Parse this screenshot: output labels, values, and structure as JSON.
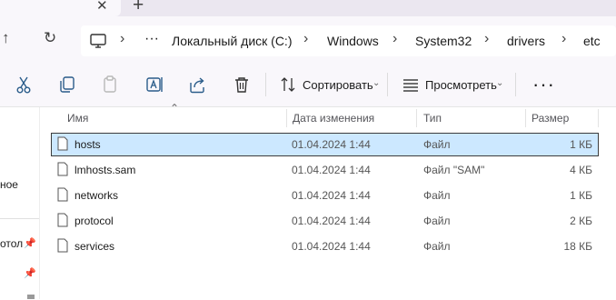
{
  "tabbar": {
    "close_glyph": "✕",
    "new_tab_glyph": "+"
  },
  "nav": {
    "up_glyph": "↑",
    "refresh_glyph": "↻",
    "crumb_more": "···",
    "crumbs": [
      "Локальный диск (C:)",
      "Windows",
      "System32",
      "drivers",
      "etc"
    ],
    "sep_glyph": "›"
  },
  "toolbar": {
    "sort_label": "Сортировать",
    "view_label": "Просмотреть",
    "chev_glyph": "⌄",
    "more_glyph": "···"
  },
  "sidebar": {
    "items": [
      "ное",
      "отол"
    ],
    "pin_glyph": "📌"
  },
  "columns": {
    "name": "Имя",
    "date": "Дата изменения",
    "type": "Тип",
    "size": "Размер",
    "sort_caret": "⌃"
  },
  "files": [
    {
      "name": "hosts",
      "date": "01.04.2024 1:44",
      "type": "Файл",
      "size": "1 КБ",
      "selected": true
    },
    {
      "name": "lmhosts.sam",
      "date": "01.04.2024 1:44",
      "type": "Файл \"SAM\"",
      "size": "4 КБ",
      "selected": false
    },
    {
      "name": "networks",
      "date": "01.04.2024 1:44",
      "type": "Файл",
      "size": "1 КБ",
      "selected": false
    },
    {
      "name": "protocol",
      "date": "01.04.2024 1:44",
      "type": "Файл",
      "size": "2 КБ",
      "selected": false
    },
    {
      "name": "services",
      "date": "01.04.2024 1:44",
      "type": "Файл",
      "size": "18 КБ",
      "selected": false
    }
  ],
  "colors": {
    "selection": "#cce8ff",
    "chrome": "#f9f7fb"
  }
}
